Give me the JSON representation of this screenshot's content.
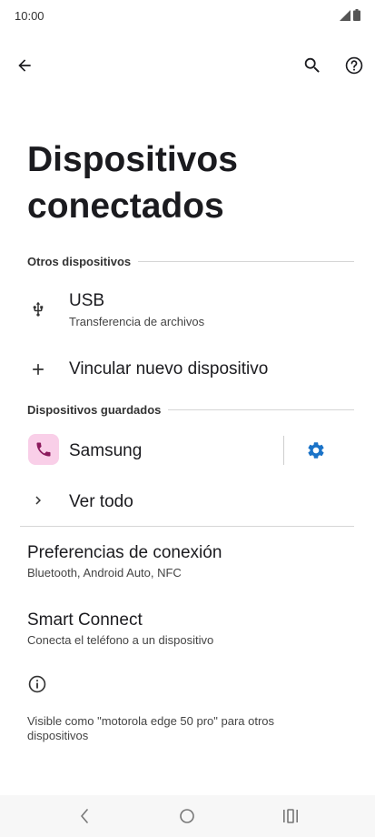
{
  "status_bar": {
    "time": "10:00"
  },
  "page": {
    "title": "Dispositivos conectados"
  },
  "sections": {
    "other": "Otros dispositivos",
    "saved": "Dispositivos guardados"
  },
  "usb": {
    "title": "USB",
    "subtitle": "Transferencia de archivos"
  },
  "pair": {
    "label": "Vincular nuevo dispositivo"
  },
  "saved_device": {
    "name": "Samsung"
  },
  "see_all": {
    "label": "Ver todo"
  },
  "prefs": {
    "title": "Preferencias de conexión",
    "subtitle": "Bluetooth, Android Auto, NFC"
  },
  "smart_connect": {
    "title": "Smart Connect",
    "subtitle": "Conecta el teléfono a un dispositivo"
  },
  "footer": {
    "visible_text": "Visible como \"motorola edge 50 pro\" para otros dispositivos"
  },
  "colors": {
    "accent": "#1a73c8",
    "device_bg": "#f9cfe8",
    "device_icon": "#8b1a5c"
  }
}
